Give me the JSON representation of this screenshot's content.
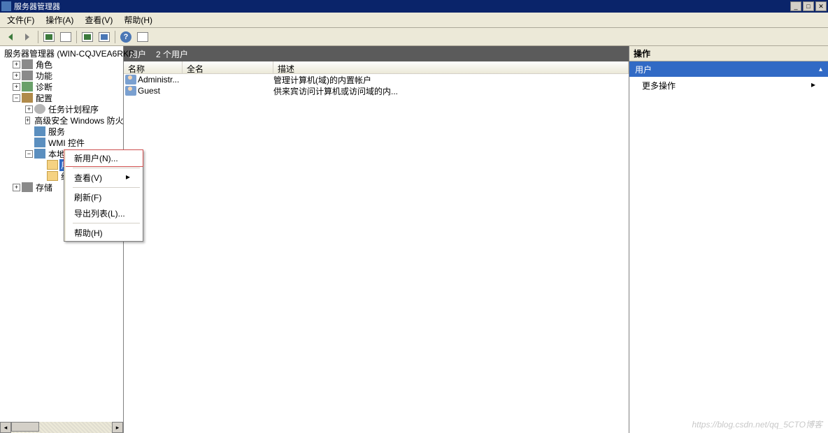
{
  "window": {
    "title": "服务器管理器"
  },
  "menu": {
    "file": "文件(F)",
    "action": "操作(A)",
    "view": "查看(V)",
    "help": "帮助(H)"
  },
  "tree": {
    "root": "服务器管理器 (WIN-CQJVEA6RKR",
    "roles": "角色",
    "features": "功能",
    "diagnostics": "诊断",
    "config": "配置",
    "task_scheduler": "任务计划程序",
    "firewall": "高级安全 Windows 防火",
    "services": "服务",
    "wmi": "WMI 控件",
    "local_users_groups": "本地用户和组",
    "users": "用户",
    "groups": "组",
    "storage": "存储"
  },
  "center": {
    "title": "用户",
    "count": "2 个用户",
    "cols": {
      "name": "名称",
      "fullname": "全名",
      "desc": "描述"
    },
    "rows": [
      {
        "name": "Administr...",
        "fullname": "",
        "desc": "管理计算机(域)的内置帐户"
      },
      {
        "name": "Guest",
        "fullname": "",
        "desc": "供来宾访问计算机或访问域的内..."
      }
    ]
  },
  "actions": {
    "header": "操作",
    "category": "用户",
    "more": "更多操作"
  },
  "context_menu": {
    "new_user": "新用户(N)...",
    "view": "查看(V)",
    "refresh": "刷新(F)",
    "export_list": "导出列表(L)...",
    "help": "帮助(H)"
  },
  "watermark": "https://blog.csdn.net/qq_5CTO博客"
}
